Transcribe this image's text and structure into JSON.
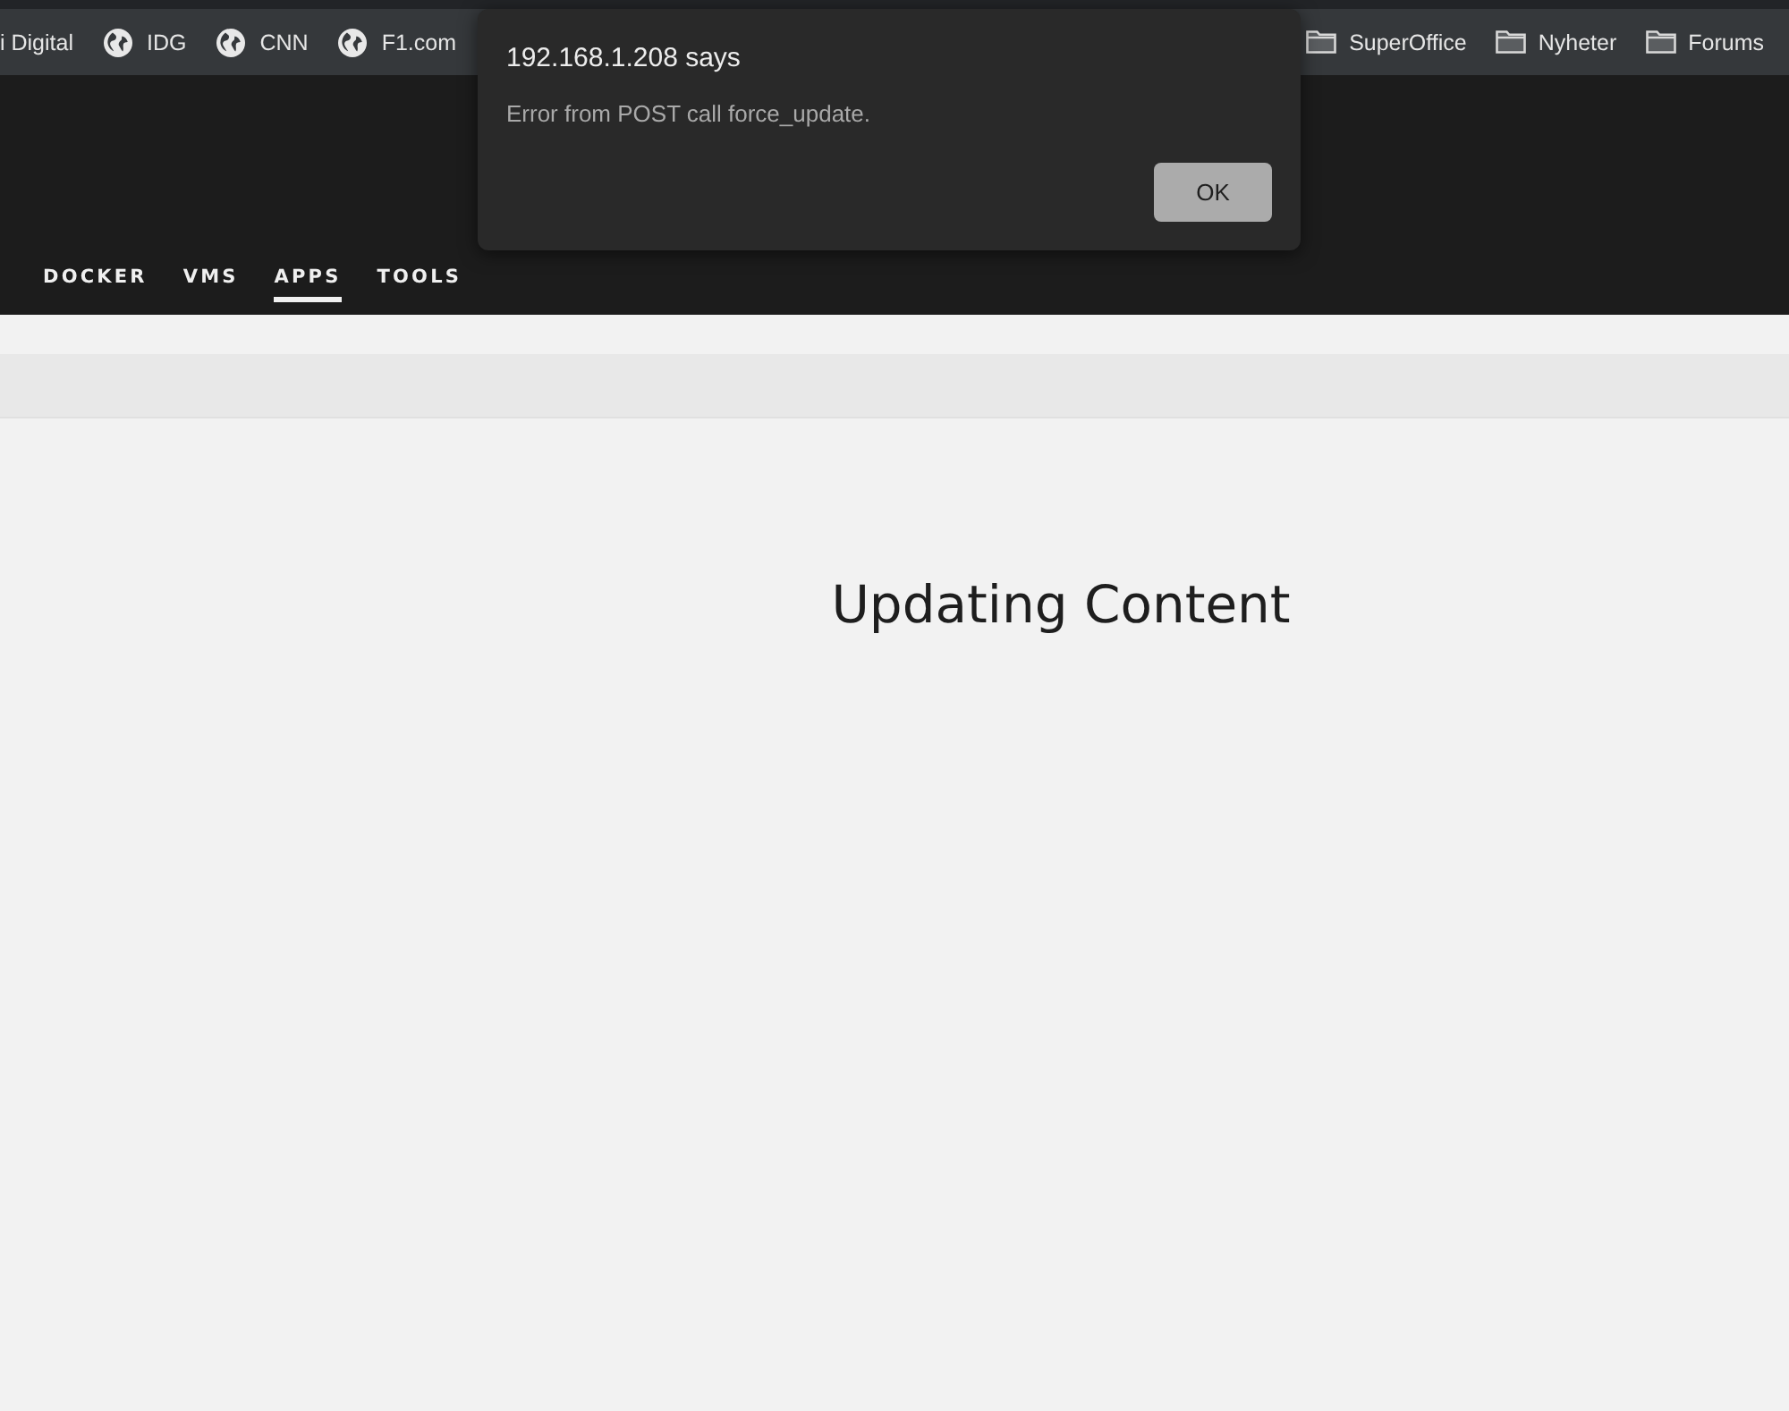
{
  "bookmarks_bar": {
    "left": [
      {
        "label": "i Digital",
        "kind": "text"
      },
      {
        "label": "IDG",
        "kind": "site"
      },
      {
        "label": "CNN",
        "kind": "site"
      },
      {
        "label": "F1.com",
        "kind": "site"
      }
    ],
    "right": [
      {
        "label": "SuperOffice",
        "kind": "folder"
      },
      {
        "label": "Nyheter",
        "kind": "folder"
      },
      {
        "label": "Forums",
        "kind": "folder"
      }
    ]
  },
  "nav": {
    "items": [
      {
        "label": "DOCKER",
        "selected": false
      },
      {
        "label": "VMS",
        "selected": false
      },
      {
        "label": "APPS",
        "selected": true
      },
      {
        "label": "TOOLS",
        "selected": false
      }
    ]
  },
  "content": {
    "heading": "Updating Content"
  },
  "dialog": {
    "title": "192.168.1.208 says",
    "message": "Error from POST call force_update.",
    "buttons": [
      "OK"
    ]
  }
}
